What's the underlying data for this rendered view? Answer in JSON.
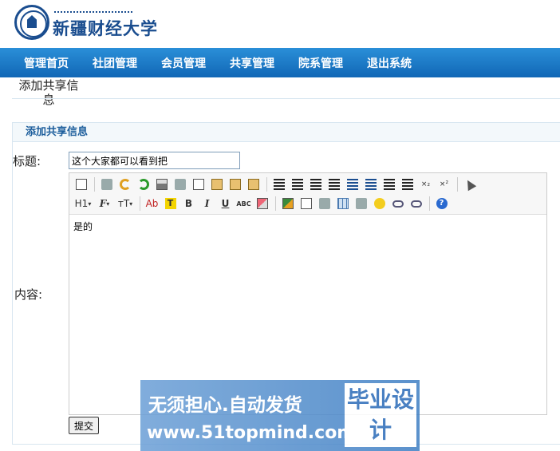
{
  "header": {
    "logo_text": "新疆财经大学"
  },
  "nav": {
    "items": [
      "管理首页",
      "社团管理",
      "会员管理",
      "共享管理",
      "院系管理",
      "退出系统"
    ]
  },
  "page": {
    "caption": "添加共享信息",
    "panel_title": "添加共享信息"
  },
  "form": {
    "title_label": "标题:",
    "title_value": "这个大家都可以看到把",
    "content_label": "内容:",
    "content_value": "是的",
    "submit_label": "提交"
  },
  "toolbar": {
    "heading_label": "H1",
    "font_label": "F",
    "size_label": "тT",
    "color_label": "Ab",
    "highlight_label": "T",
    "bold_label": "B",
    "italic_label": "I",
    "underline_label": "U",
    "strike_label": "ABC",
    "sub_label": "×₂",
    "sup_label": "×²",
    "help_label": "?"
  },
  "watermark": {
    "line1": "无须担心.自动发货",
    "line2": "www.51topmind.com",
    "box": "毕业设计"
  }
}
